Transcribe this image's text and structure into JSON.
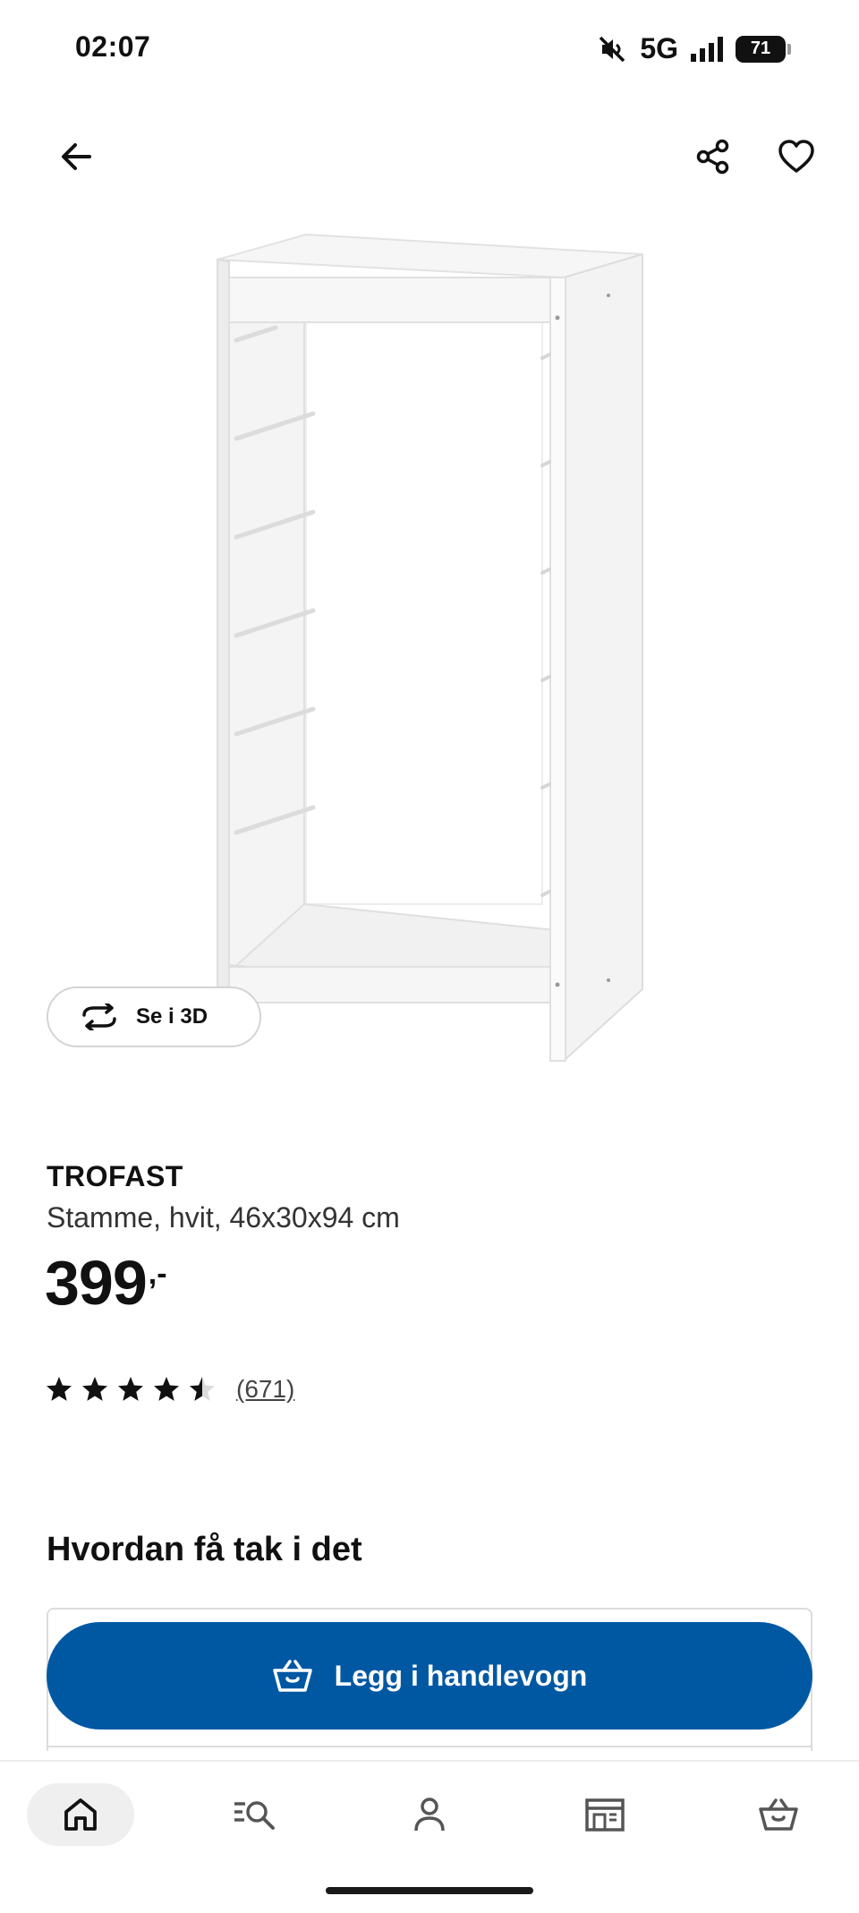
{
  "status_bar": {
    "time": "02:07",
    "network": "5G",
    "battery": "71"
  },
  "top_nav": {
    "back_icon": "arrow-left-icon",
    "share_icon": "share-icon",
    "favorite_icon": "heart-icon"
  },
  "see_3d": {
    "label": "Se i 3D",
    "icon": "rotate-3d-icon"
  },
  "product": {
    "name": "TROFAST",
    "description": "Stamme, hvit, 46x30x94 cm",
    "price": "399",
    "price_suffix": ",-",
    "rating": 4.5,
    "rating_count": "(671)"
  },
  "availability": {
    "section_title": "Hvordan få tak i det"
  },
  "add_to_cart": {
    "label": "Legg i handlevogn",
    "icon": "basket-icon"
  },
  "bottom_nav": {
    "items": [
      {
        "name": "home",
        "icon": "home-icon",
        "active": true
      },
      {
        "name": "search",
        "icon": "search-icon",
        "active": false
      },
      {
        "name": "profile",
        "icon": "profile-icon",
        "active": false
      },
      {
        "name": "store",
        "icon": "store-icon",
        "active": false
      },
      {
        "name": "cart",
        "icon": "basket-icon",
        "active": false
      }
    ]
  },
  "colors": {
    "brand_blue": "#0058a3",
    "text": "#111111",
    "active_nav_bg": "#efefef"
  }
}
